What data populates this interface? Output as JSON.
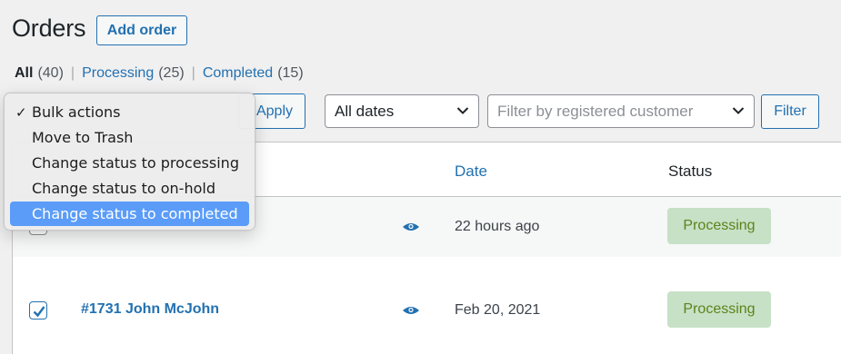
{
  "header": {
    "title": "Orders",
    "add_label": "Add order"
  },
  "filters": {
    "all_label": "All",
    "all_count": "(40)",
    "processing_label": "Processing",
    "processing_count": "(25)",
    "completed_label": "Completed",
    "completed_count": "(15)",
    "separator": "|"
  },
  "toolbar": {
    "apply_label": "Apply",
    "dates_value": "All dates",
    "customer_placeholder": "Filter by registered customer",
    "filter_label": "Filter"
  },
  "bulk_menu": {
    "check_glyph": "✓",
    "items": [
      {
        "label": "Bulk actions",
        "checked": true
      },
      {
        "label": "Move to Trash"
      },
      {
        "label": "Change status to processing"
      },
      {
        "label": "Change status to on-hold"
      },
      {
        "label": "Change status to completed",
        "highlighted": true
      }
    ]
  },
  "table": {
    "columns": {
      "date": "Date",
      "status": "Status"
    },
    "rows": [
      {
        "order": "",
        "date": "22 hours ago",
        "status": "Processing",
        "checked": false
      },
      {
        "order": "#1731 John McJohn",
        "date": "Feb 20, 2021",
        "status": "Processing",
        "checked": true
      }
    ]
  },
  "colors": {
    "accent": "#2271b1",
    "badge_bg": "#c6e1c6",
    "badge_text": "#5b841b",
    "menu_highlight": "#5a9cf8"
  }
}
